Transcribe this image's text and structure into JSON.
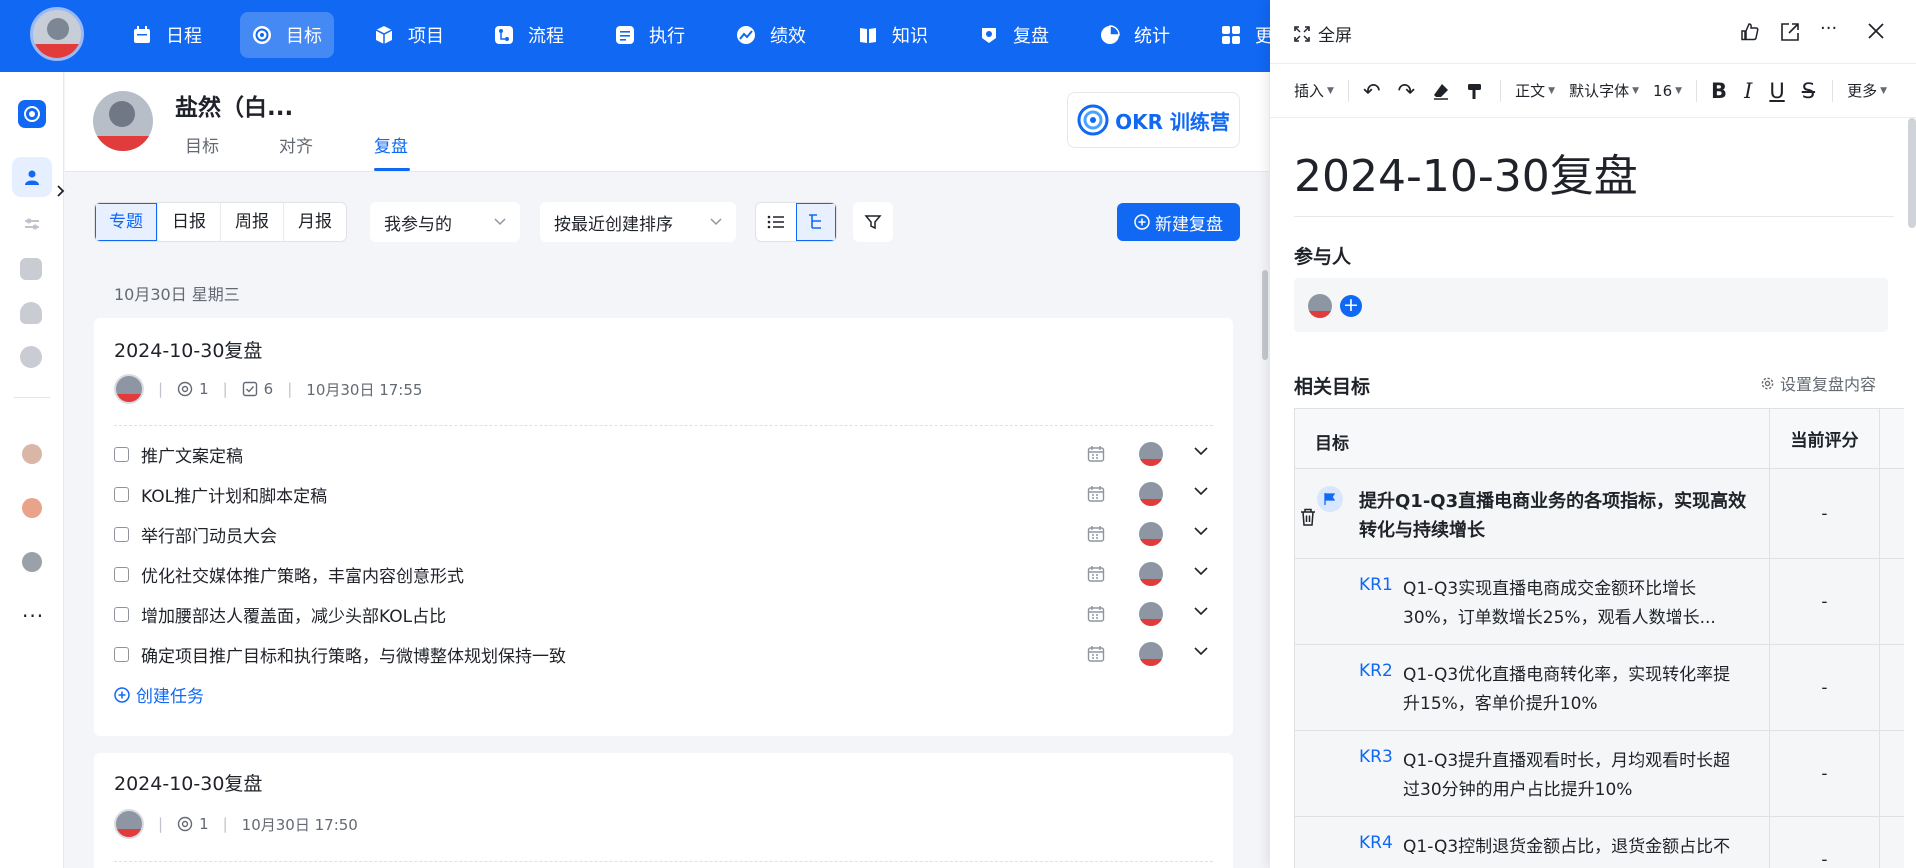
{
  "nav": {
    "items": [
      {
        "label": "日程",
        "icon": "calendar-icon"
      },
      {
        "label": "目标",
        "icon": "target-icon"
      },
      {
        "label": "项目",
        "icon": "cube-icon"
      },
      {
        "label": "流程",
        "icon": "flow-icon"
      },
      {
        "label": "执行",
        "icon": "checklist-icon"
      },
      {
        "label": "绩效",
        "icon": "chart-icon"
      },
      {
        "label": "知识",
        "icon": "book-icon"
      },
      {
        "label": "复盘",
        "icon": "review-icon"
      },
      {
        "label": "统计",
        "icon": "pie-icon"
      },
      {
        "label": "更",
        "icon": "grid-icon"
      }
    ],
    "active": "目标",
    "accent": "#1168f3"
  },
  "header": {
    "user_name": "盐然（白...",
    "tabs": [
      "目标",
      "对齐",
      "复盘"
    ],
    "active_tab": "复盘",
    "okr_badge": "OKR 训练营"
  },
  "toolbar": {
    "segments": [
      "专题",
      "日报",
      "周报",
      "月报"
    ],
    "active_segment": "专题",
    "scope_select": "我参与的",
    "sort_select": "按最近创建排序",
    "new_button": "新建复盘"
  },
  "date_label": "10月30日 星期三",
  "cards": [
    {
      "title": "2024-10-30复盘",
      "goals_count": "1",
      "tasks_count": "6",
      "time": "10月30日 17:55",
      "tasks": [
        "推广文案定稿",
        "KOL推广计划和脚本定稿",
        "举行部门动员大会",
        "优化社交媒体推广策略，丰富内容创意形式",
        "增加腰部达人覆盖面，减少头部KOL占比",
        "确定项目推广目标和执行策略，与微博整体规划保持一致"
      ],
      "create_task": "创建任务"
    },
    {
      "title": "2024-10-30复盘",
      "goals_count": "1",
      "time": "10月30日 17:50"
    }
  ],
  "panel": {
    "fullscreen": "全屏",
    "editor": {
      "insert": "插入",
      "para": "正文",
      "font": "默认字体",
      "size": "16",
      "more": "更多"
    },
    "doc_title": "2024-10-30复盘",
    "participants_title": "参与人",
    "goals_title": "相关目标",
    "settings_link": "设置复盘内容",
    "table": {
      "col_goal": "目标",
      "col_score": "当前评分",
      "objective": {
        "text": "提升Q1-Q3直播电商业务的各项指标，实现高效转化与持续增长",
        "score": "-"
      },
      "krs": [
        {
          "tag": "KR1",
          "text": "Q1-Q3实现直播电商成交金额环比增长30%，订单数增长25%，观看人数增长...",
          "score": "-"
        },
        {
          "tag": "KR2",
          "text": "Q1-Q3优化直播电商转化率，实现转化率提升15%，客单价提升10%",
          "score": "-"
        },
        {
          "tag": "KR3",
          "text": "Q1-Q3提升直播观看时长，月均观看时长超过30分钟的用户占比提升10%",
          "score": "-"
        },
        {
          "tag": "KR4",
          "text": "Q1-Q3控制退货金额占比，退货金额占比不",
          "score": "-"
        }
      ]
    }
  }
}
